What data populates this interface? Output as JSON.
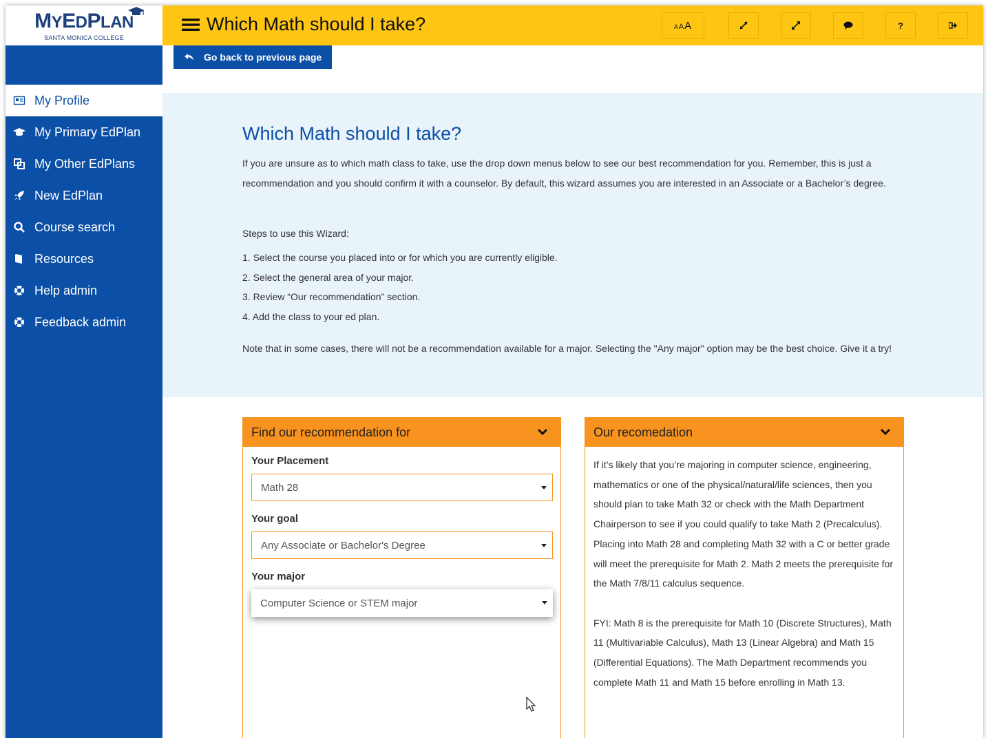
{
  "logo": {
    "text_big_m": "M",
    "text_y": "Y",
    "text_big_e": "E",
    "text_d": "D",
    "text_big_p": "P",
    "text_lan": "LAN",
    "subtitle": "SANTA MONICA COLLEGE"
  },
  "sidebar": {
    "items": [
      {
        "label": "My Profile",
        "icon": "profile-card-icon"
      },
      {
        "label": "My Primary EdPlan",
        "icon": "graduation-cap-icon"
      },
      {
        "label": "My Other EdPlans",
        "icon": "plans-icon"
      },
      {
        "label": "New EdPlan",
        "icon": "rocket-icon"
      },
      {
        "label": "Course search",
        "icon": "search-icon"
      },
      {
        "label": "Resources",
        "icon": "book-icon"
      },
      {
        "label": "Help admin",
        "icon": "lifebuoy-icon"
      },
      {
        "label": "Feedback admin",
        "icon": "lifebuoy-icon"
      }
    ]
  },
  "header": {
    "title": "Which Math should I take?",
    "font_size_btn": "AAA",
    "help_btn": "?"
  },
  "back_button": {
    "label": "Go back to previous page"
  },
  "intro": {
    "heading": "Which Math should I take?",
    "paragraph": "If you are unsure as to which math class to take, use the drop down menus below to see our best recommendation for you. Remember, this is just a recommendation and you should confirm it with a counselor. By default, this wizard assumes you are interested in an Associate or a Bachelor’s degree.",
    "steps_title": "Steps to use this Wizard:",
    "steps": [
      "1.  Select the course you placed into or for which you are currently eligible.",
      "2.  Select the general area of your major.",
      "3.  Review “Our recommendation” section.",
      "4.  Add the class to your ed plan."
    ],
    "note": "Note that in some cases, there will not be a recommendation available for a major. Selecting the \"Any major\" option may be the best choice. Give it a try!"
  },
  "find_panel": {
    "title": "Find our recommendation for",
    "placement_label": "Your Placement",
    "placement_value": "Math 28",
    "goal_label": "Your goal",
    "goal_value": "Any Associate or Bachelor's Degree",
    "major_label": "Your major",
    "major_value": "Computer Science or STEM major"
  },
  "rec_panel": {
    "title": "Our recomedation",
    "paragraph1": "If it’s likely that you’re majoring in computer science, engineering, mathematics or one of the physical/natural/life sciences, then you should plan to take Math 32 or check with the Math Department Chairperson to see if you could qualify to take Math 2 (Precalculus). Placing into Math 28 and completing Math 32 with a C or better grade will meet the prerequisite for Math 2. Math 2 meets the prerequisite for the Math 7/8/11 calculus sequence.",
    "paragraph2": "FYI: Math 8 is the prerequisite for Math 10 (Discrete Structures), Math 11 (Multivariable Calculus), Math 13 (Linear Algebra) and Math 15 (Differential Equations). The Math Department recommends you complete Math 11 and Math 15 before enrolling in Math 13."
  },
  "colors": {
    "primary_blue": "#0b4fa6",
    "header_yellow": "#fec513",
    "accent_orange": "#f7931e",
    "intro_bg": "#e9f3fa"
  }
}
